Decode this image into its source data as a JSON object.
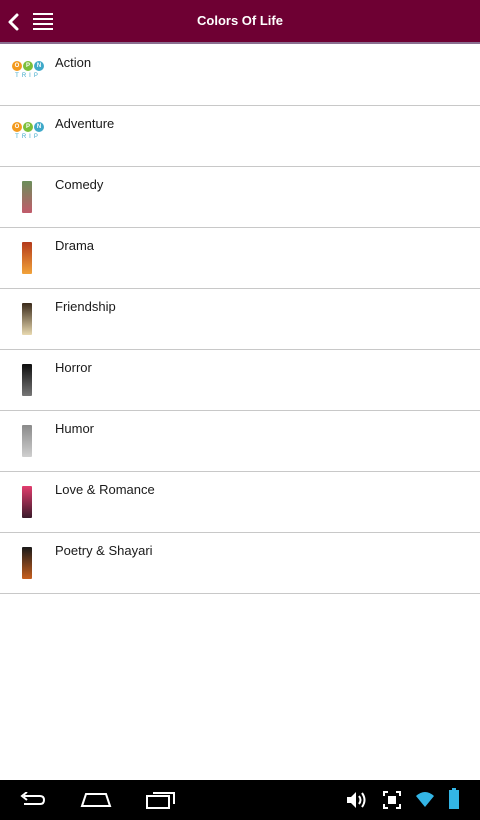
{
  "app_bar": {
    "title": "Colors Of Life",
    "back_icon": "back-arrow-icon",
    "menu_icon": "menu-icon",
    "color": "#6e0033"
  },
  "logo": {
    "letters": [
      "O",
      "P",
      "N"
    ],
    "sub": "TRIP",
    "colors": [
      "#f39a1e",
      "#7cbf3a",
      "#3fa9c9"
    ]
  },
  "categories": [
    {
      "label": "Action",
      "thumb": "open-trip-logo"
    },
    {
      "label": "Adventure",
      "thumb": "open-trip-logo"
    },
    {
      "label": "Comedy",
      "thumb": "book-cover",
      "colors": [
        "#6b8e5a",
        "#c25b6b"
      ]
    },
    {
      "label": "Drama",
      "thumb": "book-cover",
      "colors": [
        "#b33a1b",
        "#f2a33a"
      ]
    },
    {
      "label": "Friendship",
      "thumb": "book-cover",
      "colors": [
        "#3a2a1a",
        "#e8d9b0"
      ]
    },
    {
      "label": "Horror",
      "thumb": "book-cover",
      "colors": [
        "#0e0e0e",
        "#777777"
      ]
    },
    {
      "label": "Humor",
      "thumb": "book-cover",
      "colors": [
        "#8a8a8a",
        "#cfcfcf"
      ]
    },
    {
      "label": "Love & Romance",
      "thumb": "book-cover",
      "colors": [
        "#e23d6e",
        "#3a1a2a"
      ]
    },
    {
      "label": "Poetry & Shayari",
      "thumb": "book-cover",
      "colors": [
        "#1a1a1a",
        "#c8601e"
      ]
    }
  ],
  "system_nav": {
    "icons": [
      "back-icon",
      "home-icon",
      "recent-apps-icon",
      "volume-icon",
      "screenshot-icon",
      "wifi-icon",
      "battery-icon"
    ],
    "accent": "#33b5e5"
  }
}
